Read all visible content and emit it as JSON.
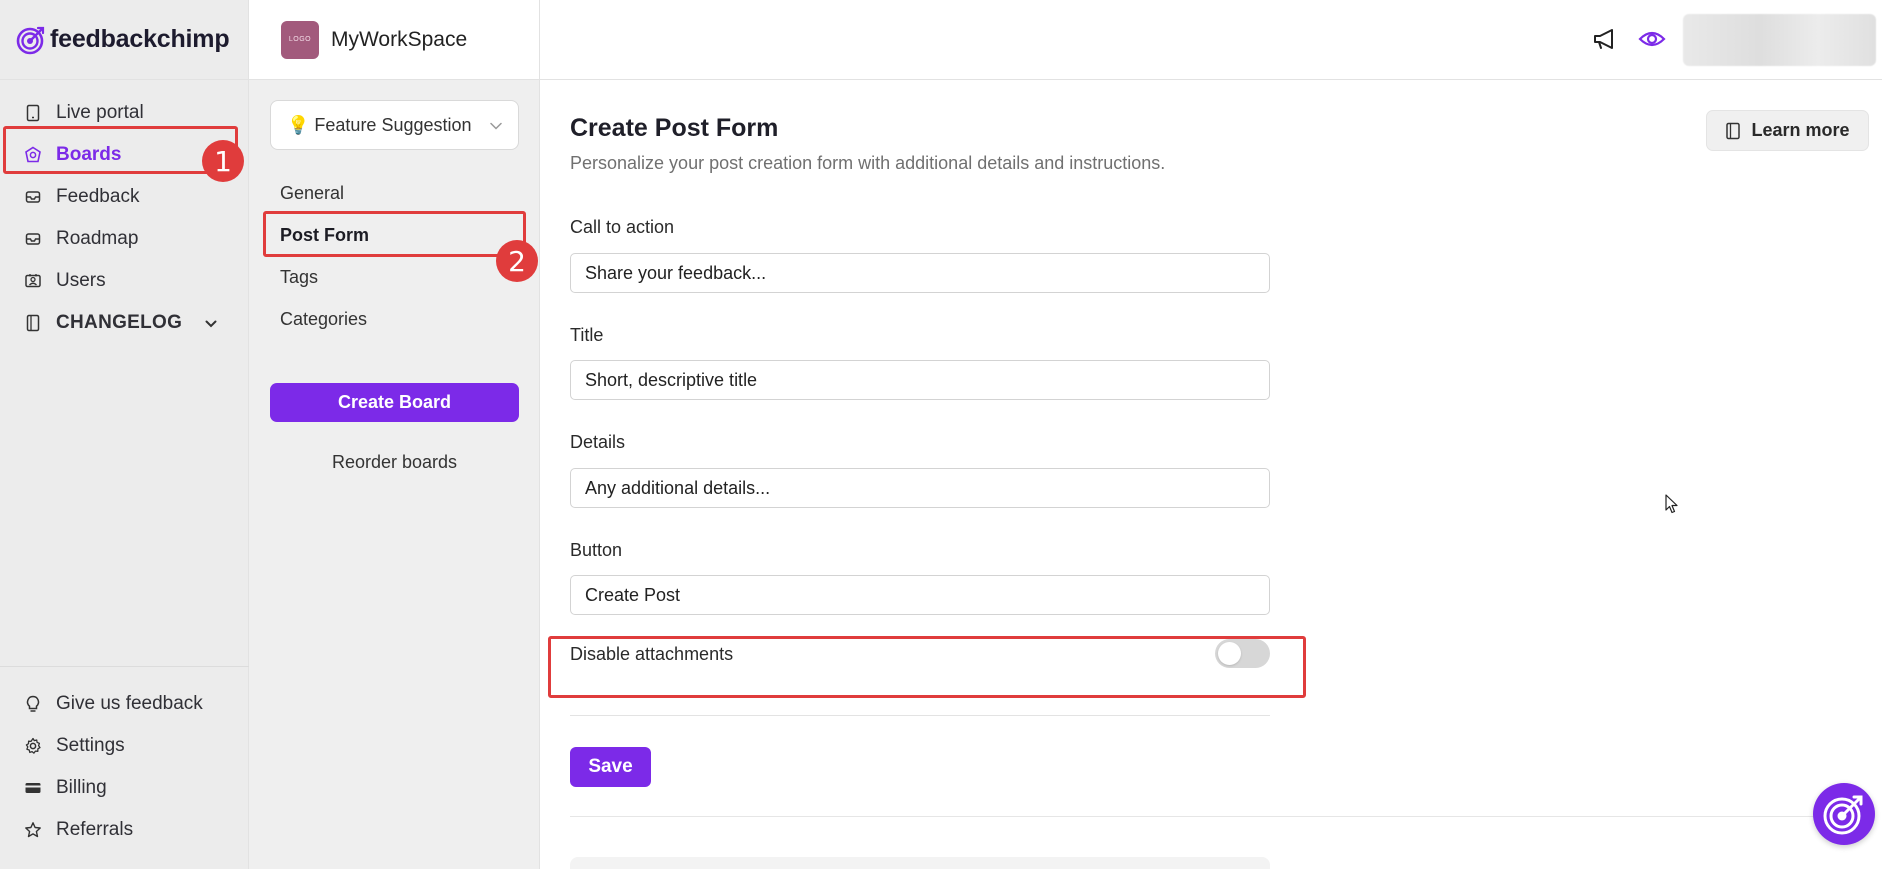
{
  "brand": {
    "name": "feedbackchimp",
    "accent_color": "#7c2ae8"
  },
  "sidebar": {
    "items": [
      {
        "label": "Live portal",
        "icon": "tablet-icon"
      },
      {
        "label": "Boards",
        "icon": "boards-icon",
        "active": true
      },
      {
        "label": "Feedback",
        "icon": "inbox-icon"
      },
      {
        "label": "Roadmap",
        "icon": "roadmap-icon"
      },
      {
        "label": "Users",
        "icon": "users-icon"
      },
      {
        "label": "CHANGELOG",
        "icon": "book-icon"
      }
    ],
    "bottom_items": [
      {
        "label": "Give us feedback",
        "icon": "lightbulb-icon"
      },
      {
        "label": "Settings",
        "icon": "gear-icon"
      },
      {
        "label": "Billing",
        "icon": "card-icon"
      },
      {
        "label": "Referrals",
        "icon": "star-icon"
      }
    ]
  },
  "workspace": {
    "logo_text": "LOGO",
    "name": "MyWorkSpace"
  },
  "board_selector": {
    "value": "💡 Feature Suggestion"
  },
  "board_nav": {
    "items": [
      {
        "label": "General"
      },
      {
        "label": "Post Form",
        "active": true
      },
      {
        "label": "Tags"
      },
      {
        "label": "Categories"
      }
    ],
    "create_button": "Create Board",
    "reorder_link": "Reorder boards"
  },
  "main": {
    "title": "Create Post Form",
    "subtitle": "Personalize your post creation form with additional details and instructions.",
    "learn_more": "Learn more",
    "fields": [
      {
        "label": "Call to action",
        "value": "Share your feedback..."
      },
      {
        "label": "Title",
        "value": "Short, descriptive title"
      },
      {
        "label": "Details",
        "value": "Any additional details..."
      },
      {
        "label": "Button",
        "value": "Create Post"
      }
    ],
    "toggle": {
      "label": "Disable attachments",
      "enabled": false
    },
    "save_button": "Save"
  },
  "annotations": {
    "badge1": "1",
    "badge2": "2",
    "highlight_color": "#e03c3c"
  }
}
